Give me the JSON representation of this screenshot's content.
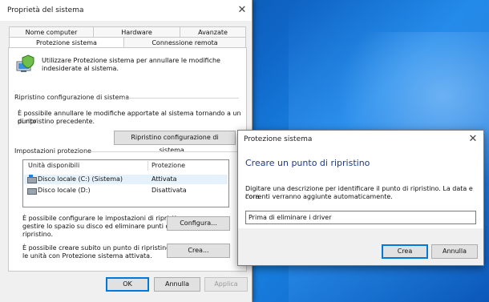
{
  "main_dialog": {
    "title": "Proprietà del sistema",
    "tabs_row1": [
      "Nome computer",
      "Hardware",
      "Avanzate"
    ],
    "tabs_row2": [
      "Protezione sistema",
      "Connessione remota"
    ],
    "active_tab": "Protezione sistema",
    "intro_line1": "Utilizzare Protezione sistema per annullare le modifiche",
    "intro_line2": "indesiderate al sistema.",
    "restore_section_title": "Ripristino configurazione di sistema",
    "restore_text_line1": "È possibile annullare le modifiche apportate al sistema tornando a un punto",
    "restore_text_line2": "di ripristino precedente.",
    "restore_button": "Ripristino configurazione di sistema...",
    "protection_section_title": "Impostazioni protezione",
    "table": {
      "columns": [
        "Unità disponibili",
        "Protezione"
      ],
      "rows": [
        {
          "drive": "Disco locale (C:) (Sistema)",
          "protection": "Attivata"
        },
        {
          "drive": "Disco locale (D:)",
          "protection": "Disattivata"
        }
      ]
    },
    "configure_text_line1": "È possibile configurare le impostazioni di ripristino,",
    "configure_text_line2": "gestire lo spazio su disco ed eliminare punti di",
    "configure_text_line3": "ripristino.",
    "configure_button": "Configura...",
    "create_text_line1": "È possibile creare subito un punto di ripristino per",
    "create_text_line2": "le unità con Protezione sistema attivata.",
    "create_button": "Crea...",
    "ok_button": "OK",
    "cancel_button": "Annulla",
    "apply_button": "Applica"
  },
  "sub_dialog": {
    "title": "Protezione sistema",
    "heading": "Creare un punto di ripristino",
    "description_line1": "Digitare una descrizione per identificare il punto di ripristino. La data e l'ora",
    "description_line2": "correnti verranno aggiunte automaticamente.",
    "input_value": "Prima di eliminare i driver",
    "create_button": "Crea",
    "cancel_button": "Annulla"
  },
  "colors": {
    "accent": "#0078d7",
    "heading_blue": "#1e3a8a",
    "selection": "#e5f1fb",
    "desktop_blue": "#0f66c7"
  },
  "icons": [
    "close-icon",
    "system-protection-icon",
    "drive-icon"
  ]
}
